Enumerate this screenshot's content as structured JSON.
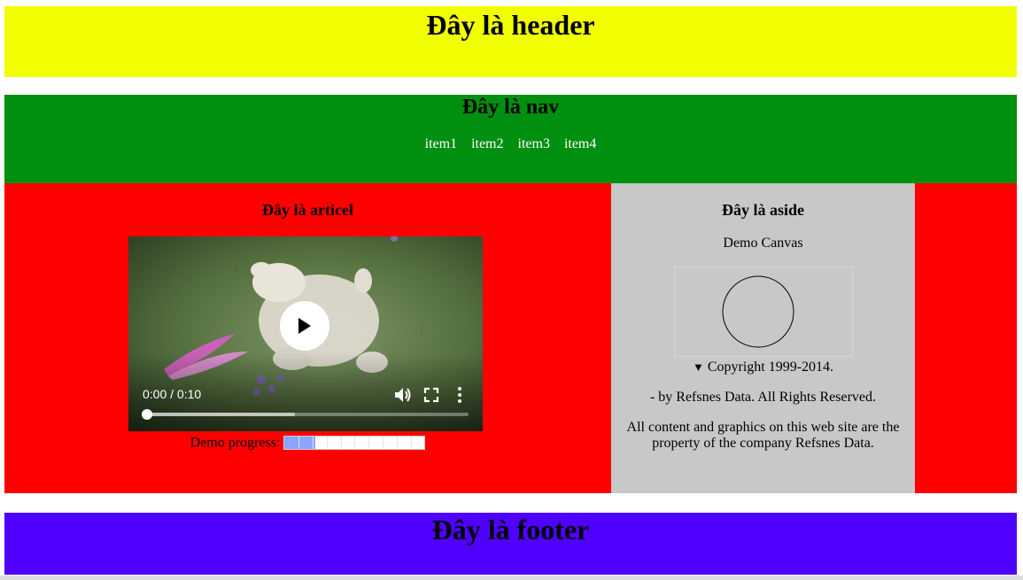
{
  "header": {
    "title": "Đây là header",
    "color": "#f2ff00"
  },
  "nav": {
    "title": "Đây là nav",
    "color": "#008f0e",
    "items": [
      "item1",
      "item2",
      "item3",
      "item4"
    ]
  },
  "article": {
    "title": "Đây là articel",
    "color": "#ff0000",
    "video": {
      "time": "0:00 / 0:10",
      "state": "paused",
      "icons": [
        "play-icon",
        "volume-icon",
        "fullscreen-icon",
        "more-options-icon"
      ]
    },
    "progress": {
      "label": "Demo progress:",
      "value": 0.22,
      "color": "#8aa4ff"
    }
  },
  "aside": {
    "title": "Đây là aside",
    "canvas_title": "Demo Canvas",
    "summary": "Copyright 1999-2014.",
    "by_line": "- by Refsnes Data. All Rights Reserved.",
    "content": "All content and graphics on this web site are the property of the company Refsnes Data.",
    "color": "#c8c8c8"
  },
  "footer": {
    "title": "Đây là footer",
    "color": "#5000ff"
  }
}
